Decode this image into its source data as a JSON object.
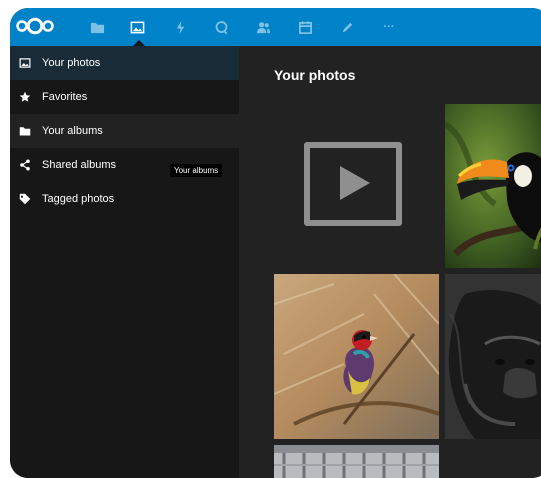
{
  "header": {
    "color": "#0082c9",
    "icons": [
      "nextcloud-logo",
      "files-icon",
      "photos-icon",
      "activity-icon",
      "search-icon",
      "contacts-icon",
      "calendar-icon",
      "notes-icon",
      "more-icon"
    ],
    "more_label": "···"
  },
  "sidebar": {
    "items": [
      {
        "label": "Your photos",
        "icon": "image-icon"
      },
      {
        "label": "Favorites",
        "icon": "star-icon"
      },
      {
        "label": "Your albums",
        "icon": "folder-icon"
      },
      {
        "label": "Shared albums",
        "icon": "share-icon"
      },
      {
        "label": "Tagged photos",
        "icon": "tag-icon"
      }
    ],
    "tooltip": "Your albums"
  },
  "main": {
    "title": "Your photos",
    "tiles": [
      "video",
      "toucan",
      "finch",
      "gorilla",
      "building"
    ]
  }
}
